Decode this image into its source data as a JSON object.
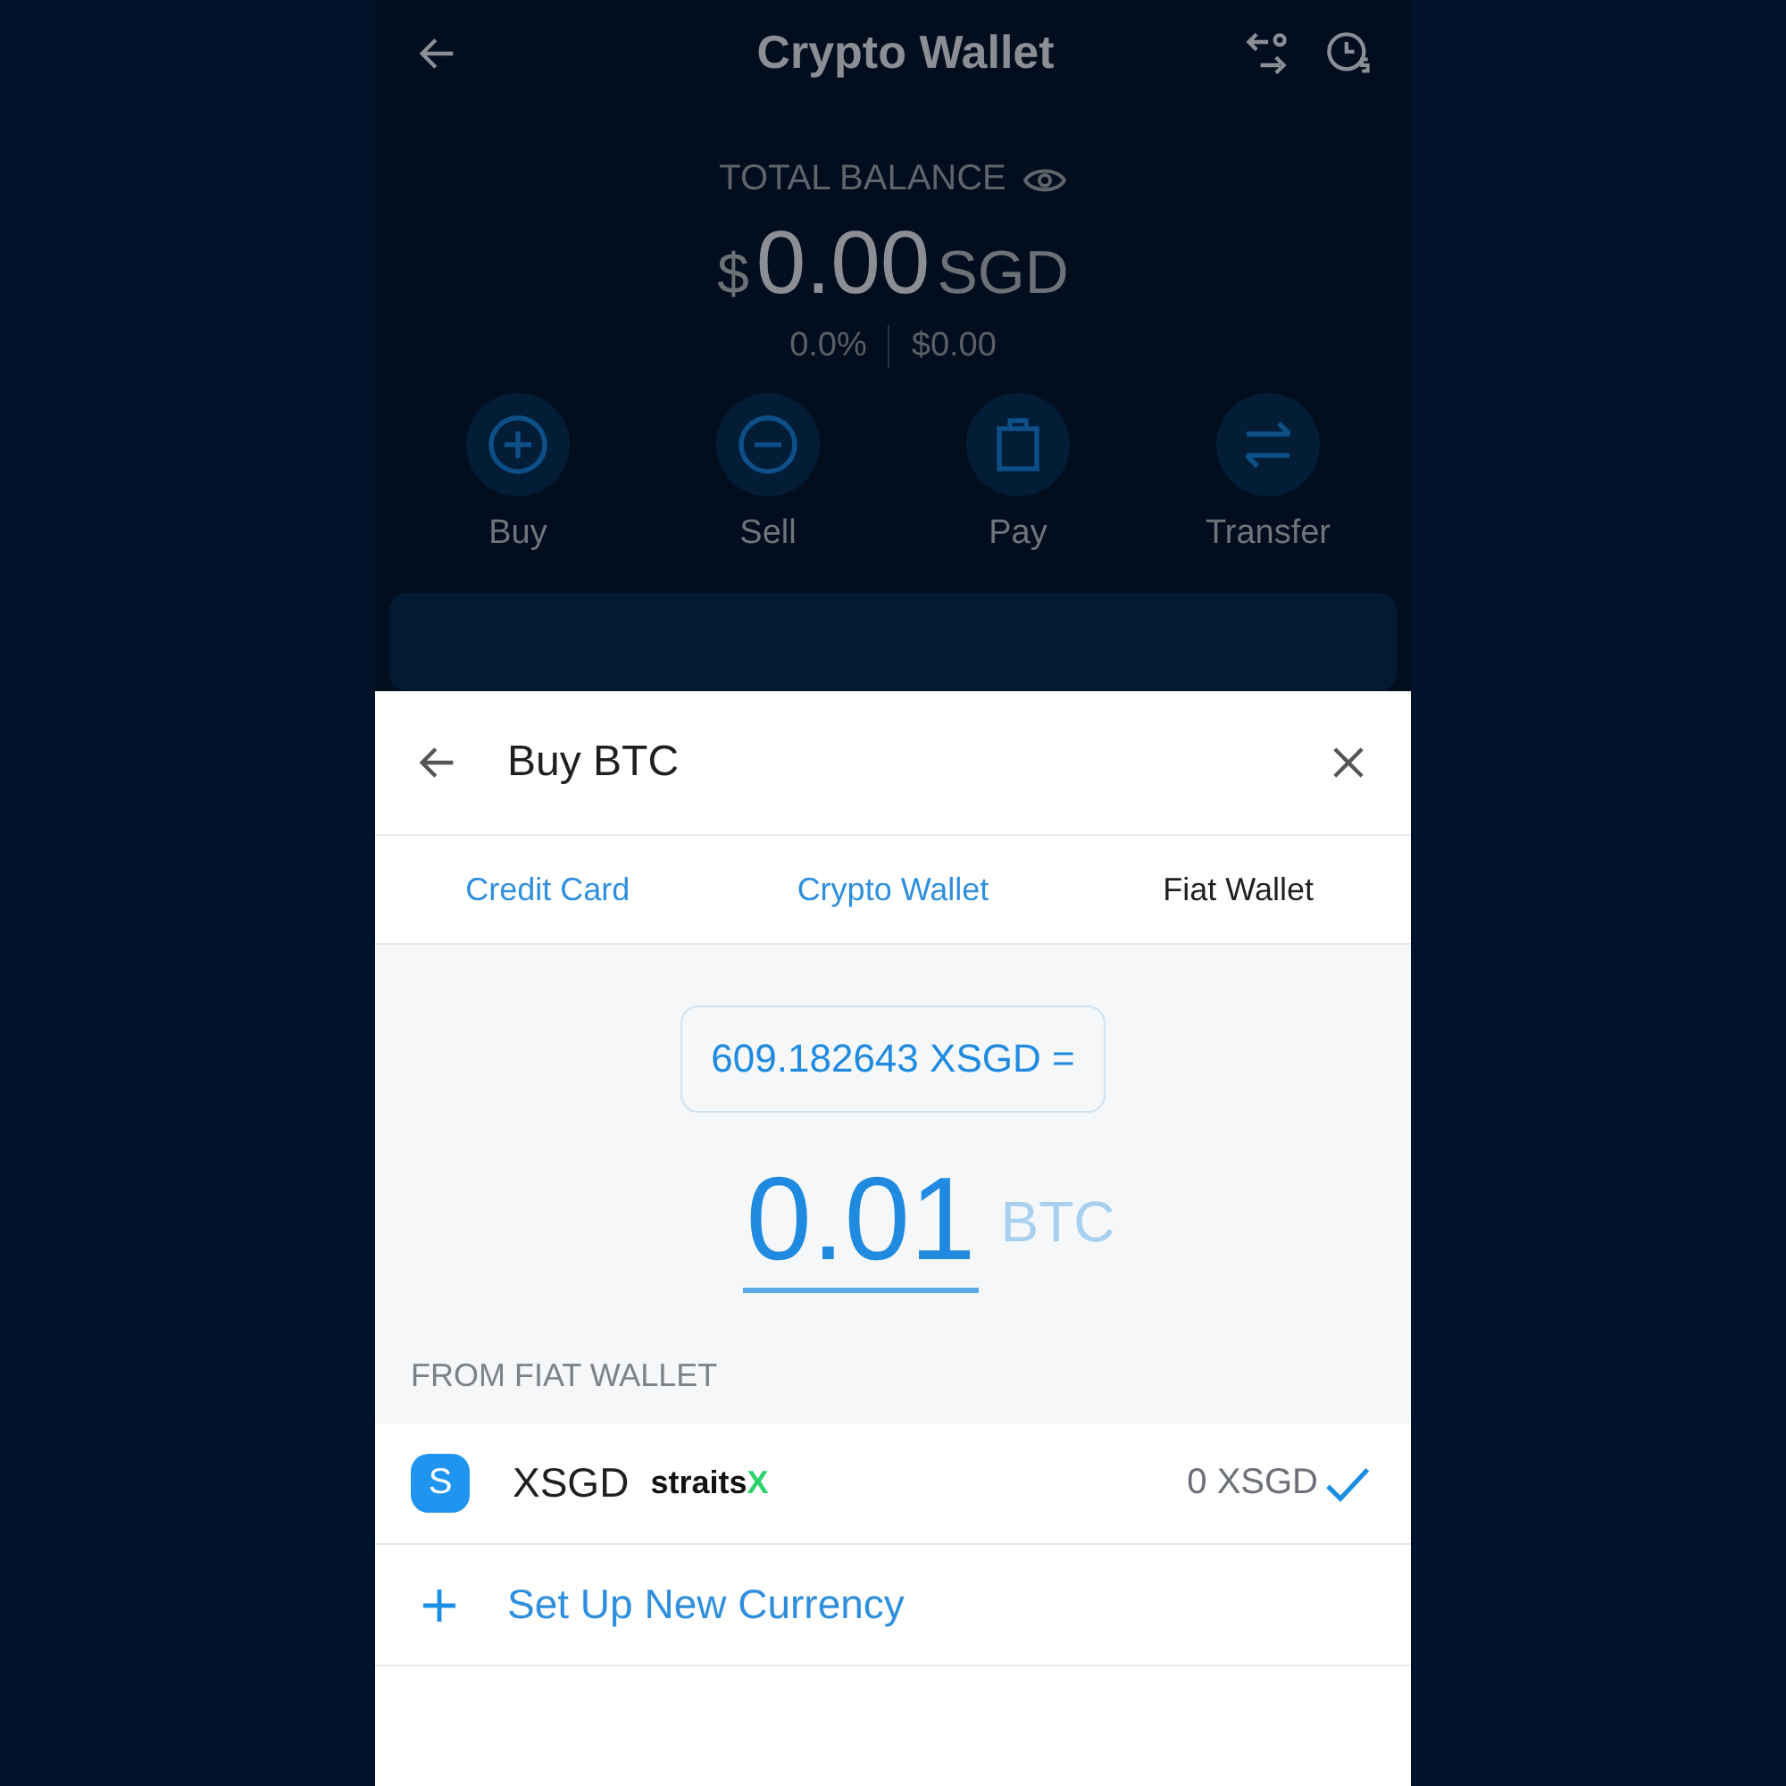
{
  "background_screen": {
    "title": "Crypto Wallet",
    "balance_label": "TOTAL BALANCE",
    "currency_symbol": "$",
    "balance": "0.00",
    "currency": "SGD",
    "change_percent": "0.0%",
    "change_amount": "$0.00",
    "actions": [
      {
        "kind": "buy",
        "label": "Buy"
      },
      {
        "kind": "sell",
        "label": "Sell"
      },
      {
        "kind": "pay",
        "label": "Pay"
      },
      {
        "kind": "transfer",
        "label": "Transfer"
      }
    ]
  },
  "sheet": {
    "title": "Buy BTC",
    "tabs": [
      {
        "label": "Credit Card",
        "selected": false
      },
      {
        "label": "Crypto Wallet",
        "selected": false
      },
      {
        "label": "Fiat Wallet",
        "selected": true
      }
    ],
    "conversion": "609.182643 XSGD =",
    "amount": "0.01",
    "amount_unit": "BTC",
    "section_label": "FROM FIAT WALLET",
    "wallets": [
      {
        "badge": "S",
        "name": "XSGD",
        "logo_text": "straits",
        "logo_mark": "X",
        "balance": "0 XSGD",
        "selected": true
      }
    ],
    "add_currency": "Set Up New Currency"
  }
}
